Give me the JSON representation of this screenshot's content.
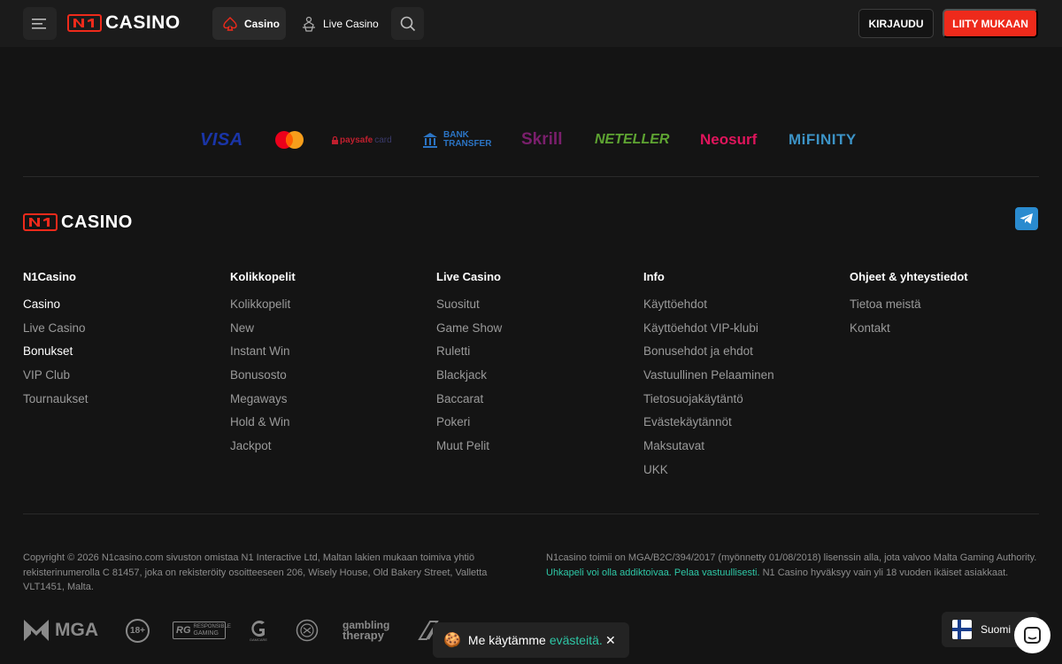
{
  "header": {
    "logo_text": "CASINO",
    "nav_casino": "Casino",
    "nav_live_casino": "Live Casino",
    "login_label": "KIRJAUDU",
    "join_label": "LIITY MUKAAN",
    "accent_color": "#ee2a1b"
  },
  "payments": {
    "visa": "VISA",
    "paysafecard_a": "paysafe",
    "paysafecard_b": "card",
    "bank_transfer_line1": "BANK",
    "bank_transfer_line2": "TRANSFER",
    "skrill": "Skrill",
    "neteller": "NETELLER",
    "neosurf": "Neosurf",
    "mifinity": "MiFINITY"
  },
  "footer": {
    "logo_text": "CASINO",
    "columns": [
      {
        "title": "N1Casino",
        "links": [
          "Casino",
          "Live Casino",
          "Bonukset",
          "VIP Club",
          "Tournaukset"
        ]
      },
      {
        "title": "Kolikkopelit",
        "links": [
          "Kolikkopelit",
          "New",
          "Instant Win",
          "Bonusosto",
          "Megaways",
          "Hold & Win",
          "Jackpot"
        ]
      },
      {
        "title": "Live Casino",
        "links": [
          "Suositut",
          "Game Show",
          "Ruletti",
          "Blackjack",
          "Baccarat",
          "Pokeri",
          "Muut Pelit"
        ]
      },
      {
        "title": "Info",
        "links": [
          "Käyttöehdot",
          "Käyttöehdot VIP-klubi",
          "Bonusehdot ja ehdot",
          "Vastuullinen Pelaaminen",
          "Tietosuojakäytäntö",
          "Evästekäytännöt",
          "Maksutavat",
          "UKK"
        ]
      },
      {
        "title": "Ohjeet & yhteystiedot",
        "links": [
          "Tietoa meistä",
          "Kontakt"
        ]
      }
    ],
    "copyright": "Copyright © 2026 N1casino.com sivuston omistaa N1 Interactive Ltd, Maltan lakien mukaan toimiva yhtiö rekisterinumerolla C 81457, joka on rekisteröity osoitteeseen 206, Wisely House, Old Bakery Street, Valletta VLT1451, Malta.",
    "license_a": "N1casino toimii on MGA/B2C/394/2017 (myönnetty 01/08/2018) lisenssin alla, jota valvoo Malta Gaming Authority.",
    "license_link": "Uhkapeli voi olla addiktoivaa. Pelaa vastuullisesti.",
    "license_b": "N1 Casino hyväksyy vain yli 18 vuoden ikäiset asiakkaat.",
    "highlight_color": "#2ec7a6",
    "badges": {
      "mga": "MGA",
      "age": "18+",
      "rg_line1": "RESPONSIBLE",
      "rg_line2": "GAMING",
      "gamcare": "GAMCARE",
      "gambling_therapy_1": "gambling",
      "gambling_therapy_2": "therapy"
    }
  },
  "cookie": {
    "text": "Me käytämme",
    "link": "evästeitä."
  },
  "language": {
    "label": "Suomi"
  }
}
